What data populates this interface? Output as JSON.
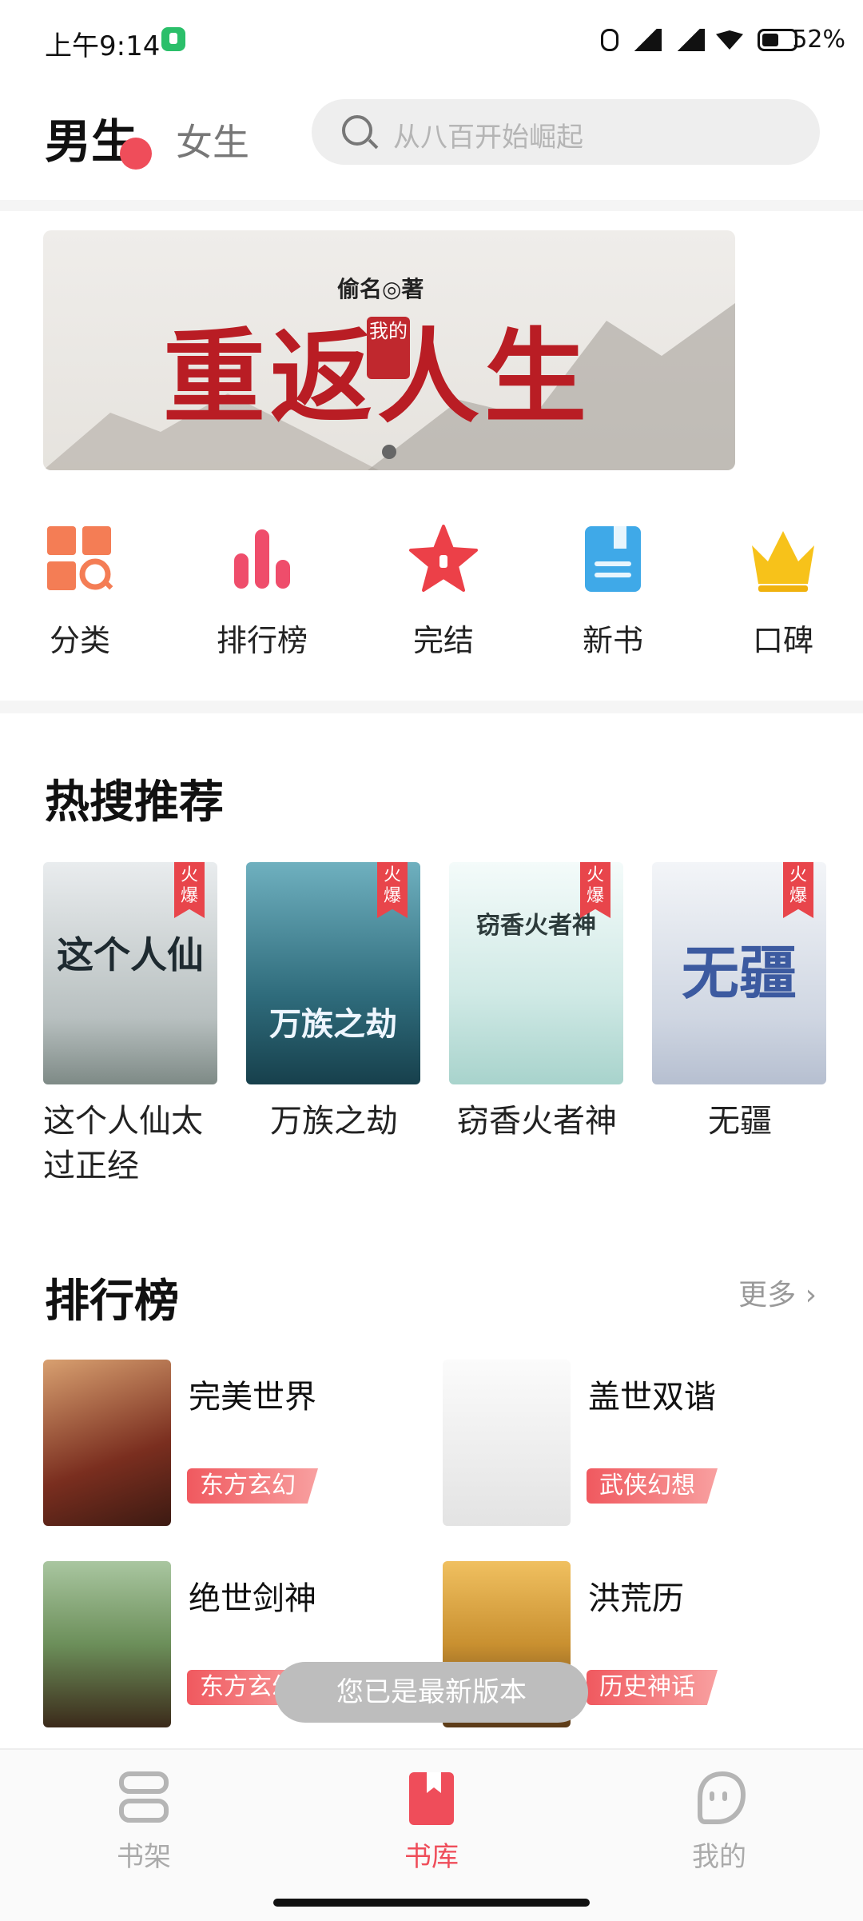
{
  "status_bar": {
    "time": "上午9:14",
    "battery": "52%",
    "battery_level": 0.52
  },
  "header": {
    "tab_male": "男生",
    "tab_female": "女生",
    "search_placeholder": "从八百开始崛起"
  },
  "banner": {
    "author": "偷名◎著",
    "title_main": "重返人生",
    "title_seal": "我的",
    "page_count": 1,
    "active_page": 0
  },
  "quick_links": [
    {
      "label": "分类",
      "icon": "category-icon"
    },
    {
      "label": "排行榜",
      "icon": "ranking-icon"
    },
    {
      "label": "完结",
      "icon": "completed-star-icon"
    },
    {
      "label": "新书",
      "icon": "new-book-icon"
    },
    {
      "label": "口碑",
      "icon": "crown-icon"
    }
  ],
  "hot_search": {
    "title": "热搜推荐",
    "books": [
      {
        "name": "这个人仙太过正经",
        "cover_text": "这个人仙",
        "badge": "火爆",
        "cover_color": "#dfe3e6"
      },
      {
        "name": "万族之劫",
        "cover_text": "万族之劫",
        "badge": "火爆",
        "cover_color": "#3f7f8f"
      },
      {
        "name": "窃香火者神",
        "cover_text": "窃香火者神",
        "badge": "火爆",
        "cover_color": "#dff0ee"
      },
      {
        "name": "无疆",
        "cover_text": "无疆",
        "badge": "火爆",
        "cover_color": "#dfe6f0"
      }
    ]
  },
  "ranking": {
    "title": "排行榜",
    "more_label": "更多",
    "items": [
      {
        "name": "完美世界",
        "genre": "东方玄幻",
        "cover_color": "#7a2e1f"
      },
      {
        "name": "盖世双谐",
        "genre": "武侠幻想",
        "cover_color": "#f2f2f2"
      },
      {
        "name": "绝世剑神",
        "genre": "东方玄幻",
        "cover_color": "#6c8f5a"
      },
      {
        "name": "洪荒历",
        "genre": "历史神话",
        "cover_color": "#c99030"
      }
    ]
  },
  "toast": "您已是最新版本",
  "bottom_nav": [
    {
      "label": "书架",
      "active": false
    },
    {
      "label": "书库",
      "active": true
    },
    {
      "label": "我的",
      "active": false
    }
  ],
  "colors": {
    "accent": "#ef4d5a",
    "tag": "#e8454b",
    "muted": "#aaaaaa"
  }
}
